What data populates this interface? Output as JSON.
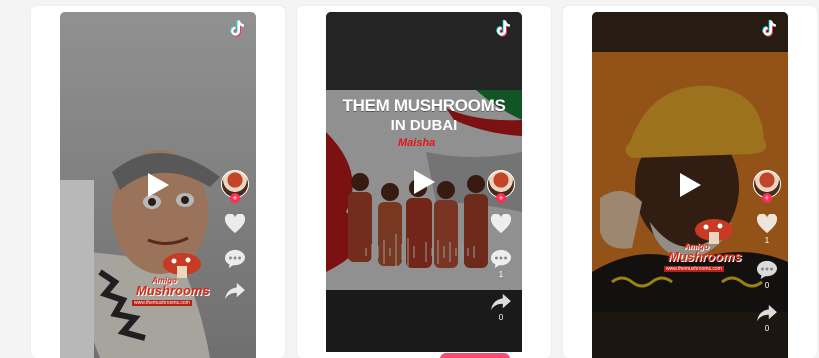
{
  "cards": [
    {
      "brand_top": "Amigo",
      "brand_main": "Mushrooms",
      "brand_url": "www.themushrooms.com",
      "counts": {
        "comment": "",
        "share": ""
      }
    },
    {
      "headline_1": "THEM MUSHROOMS",
      "headline_2": "IN DUBAI",
      "headline_3": "Maisha",
      "counts": {
        "like": "",
        "comment": "1",
        "share": "0"
      }
    },
    {
      "brand_top": "Amigo",
      "brand_main": "Mushrooms",
      "brand_url": "www.themushrooms.com",
      "counts": {
        "like": "1",
        "comment": "0",
        "share": "0"
      }
    }
  ],
  "icons": {
    "platform": "tiktok-icon",
    "play": "play-icon",
    "like": "heart-icon",
    "comment": "comment-icon",
    "share": "share-icon"
  },
  "colors": {
    "tiktok_accent": "#fe2c55",
    "tiktok_cyan": "#25f4ee",
    "overlay_dim": "rgba(0,0,0,0.45)"
  }
}
